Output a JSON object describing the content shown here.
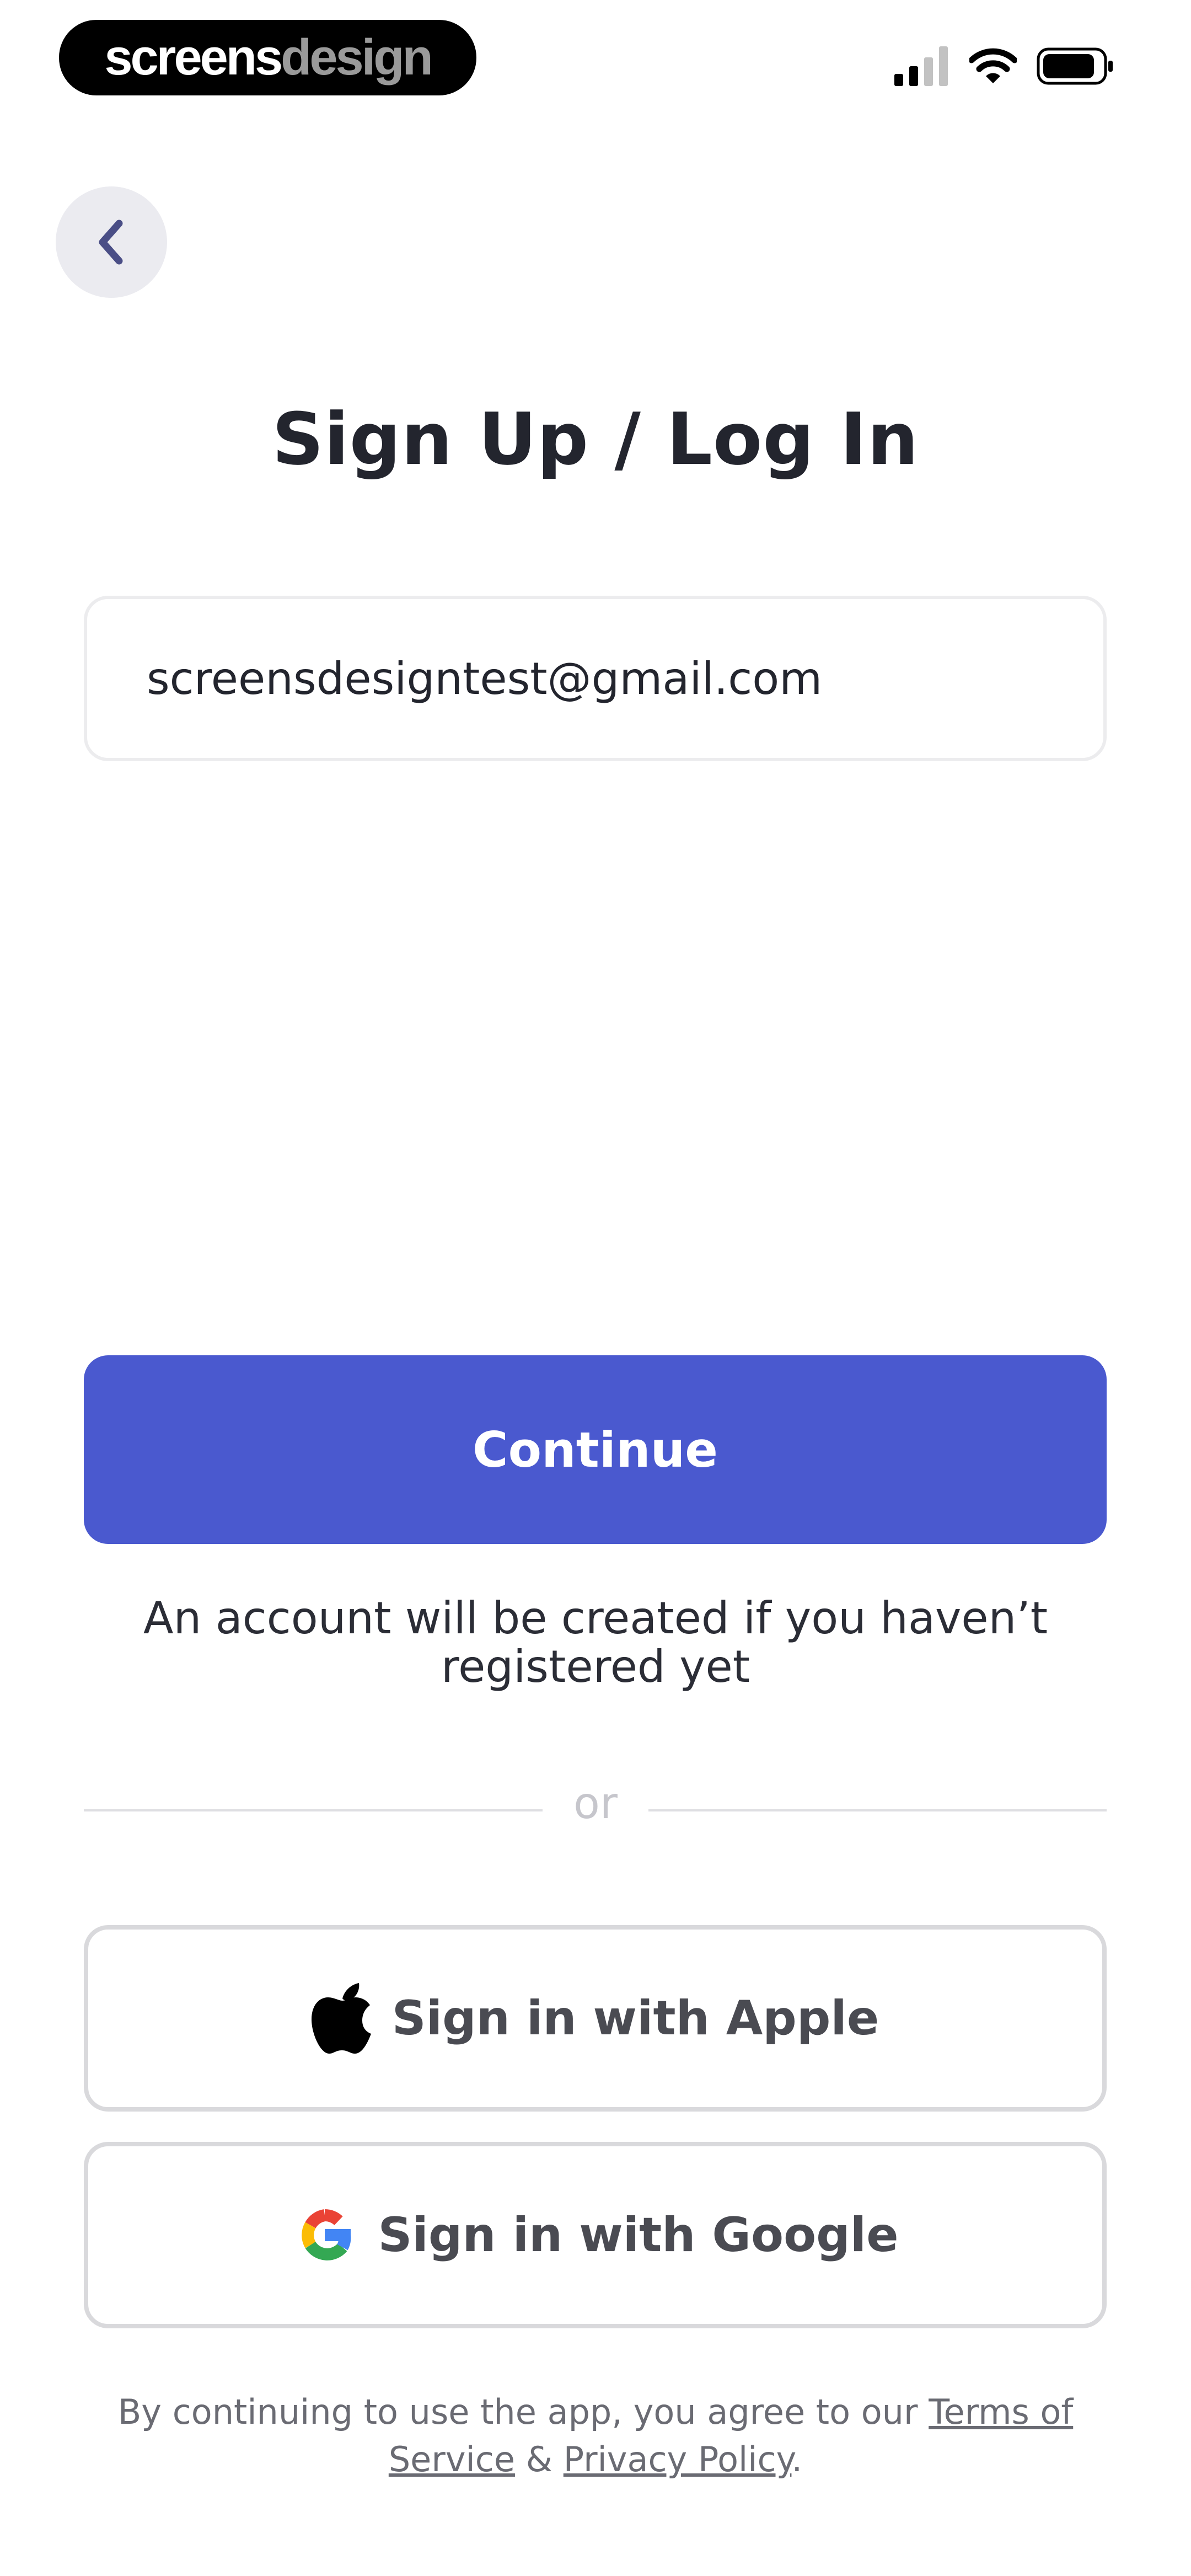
{
  "status_bar": {
    "brand_bold": "screens",
    "brand_light": "design",
    "icons": [
      "signal-icon",
      "wifi-icon",
      "battery-icon"
    ]
  },
  "nav": {
    "back_icon": "chevron-left-icon"
  },
  "title": "Sign Up / Log In",
  "email_field": {
    "value": "screensdesigntest@gmail.com"
  },
  "continue_label": "Continue",
  "helper_text": "An account will be created if you haven’t registered yet",
  "divider_label": "or",
  "social": {
    "apple_label": "Sign in with Apple",
    "google_label": "Sign in with Google"
  },
  "legal": {
    "prefix": "By continuing to use the app, you agree to our",
    "terms": "Terms of Service",
    "joiner": "&",
    "privacy": "Privacy Policy",
    "suffix": "."
  },
  "colors": {
    "accent": "#4a59cf",
    "text_dark": "#23252e",
    "border": "#d9d9dc",
    "back_button_bg": "#ebebf0",
    "google_blue": "#4285F4",
    "google_red": "#EA4335",
    "google_yellow": "#FBBC05",
    "google_green": "#34A853"
  }
}
